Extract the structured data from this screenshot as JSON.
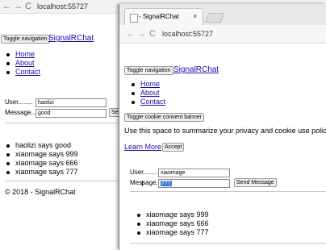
{
  "back": {
    "toolbar": {
      "back": "←",
      "forward": "→",
      "reload": "C",
      "url": "localhost:55727"
    },
    "toggle_nav": "Toggle navigation",
    "brand": "SignalRChat",
    "nav": [
      "Home",
      "About",
      "Contact"
    ],
    "user_label": "User........",
    "user_value": "haolizi",
    "message_label": "Message...",
    "message_value": "good",
    "send_label": "Send",
    "messages": [
      "haolizi says good",
      "xiaomage says 999",
      "xiaomage says 666",
      "xiaomage says 777"
    ],
    "footer": "© 2018 - SignalRChat"
  },
  "front": {
    "tab_title": "- SignalRChat",
    "tab_close": "×",
    "toolbar": {
      "back": "←",
      "forward": "→",
      "reload": "C",
      "url": "localhost:55727"
    },
    "toggle_nav": "Toggle navigation",
    "brand": "SignalRChat",
    "nav": [
      "Home",
      "About",
      "Contact"
    ],
    "toggle_cookie": "Toggle cookie consent banner",
    "privacy_text": "Use this space to summarize your privacy and cookie use policy.",
    "learn_more": "Learn More",
    "accept": "Accept",
    "user_label": "User........",
    "user_value": "xiaomage",
    "message_label": "Message...",
    "message_value": "777",
    "send_label": "Send Message",
    "messages": [
      "xiaomage says 999",
      "xiaomage says 666",
      "xiaomage says 777"
    ]
  }
}
